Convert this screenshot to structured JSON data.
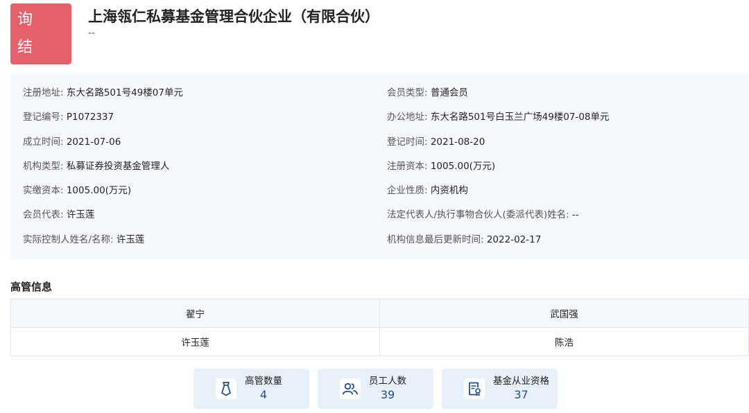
{
  "badge": {
    "line1": "查 询",
    "line2": "结 果"
  },
  "company": {
    "name": "上海瓴仁私募基金管理合伙企业（有限合伙）",
    "subtitle": "--"
  },
  "info_left": [
    {
      "label": "注册地址: ",
      "value": "东大名路501号49楼07单元"
    },
    {
      "label": "登记编号: ",
      "value": "P1072337"
    },
    {
      "label": "成立时间: ",
      "value": "2021-07-06"
    },
    {
      "label": "机构类型: ",
      "value": "私募证券投资基金管理人"
    },
    {
      "label": "实缴资本: ",
      "value": "1005.00(万元)"
    },
    {
      "label": "会员代表: ",
      "value": "许玉莲"
    },
    {
      "label": "实际控制人姓名/名称: ",
      "value": "许玉莲"
    }
  ],
  "info_right": [
    {
      "label": "会员类型: ",
      "value": "普通会员"
    },
    {
      "label": "办公地址: ",
      "value": "东大名路501号白玉兰广场49楼07-08单元"
    },
    {
      "label": "登记时间: ",
      "value": "2021-08-20"
    },
    {
      "label": "注册资本: ",
      "value": "1005.00(万元)"
    },
    {
      "label": "企业性质: ",
      "value": "内资机构"
    },
    {
      "label": "法定代表人/执行事物合伙人(委派代表)姓名: ",
      "value": "--"
    },
    {
      "label": "机构信息最后更新时间: ",
      "value": "2022-02-17"
    }
  ],
  "executives": {
    "title": "高管信息",
    "rows": [
      [
        "翟宁",
        "武国强"
      ],
      [
        "许玉莲",
        "陈浩"
      ]
    ]
  },
  "stats": [
    {
      "label": "高管数量",
      "value": "4",
      "icon": "tie-icon"
    },
    {
      "label": "员工人数",
      "value": "39",
      "icon": "people-icon"
    },
    {
      "label": "基金从业资格",
      "value": "37",
      "icon": "certificate-icon"
    }
  ]
}
